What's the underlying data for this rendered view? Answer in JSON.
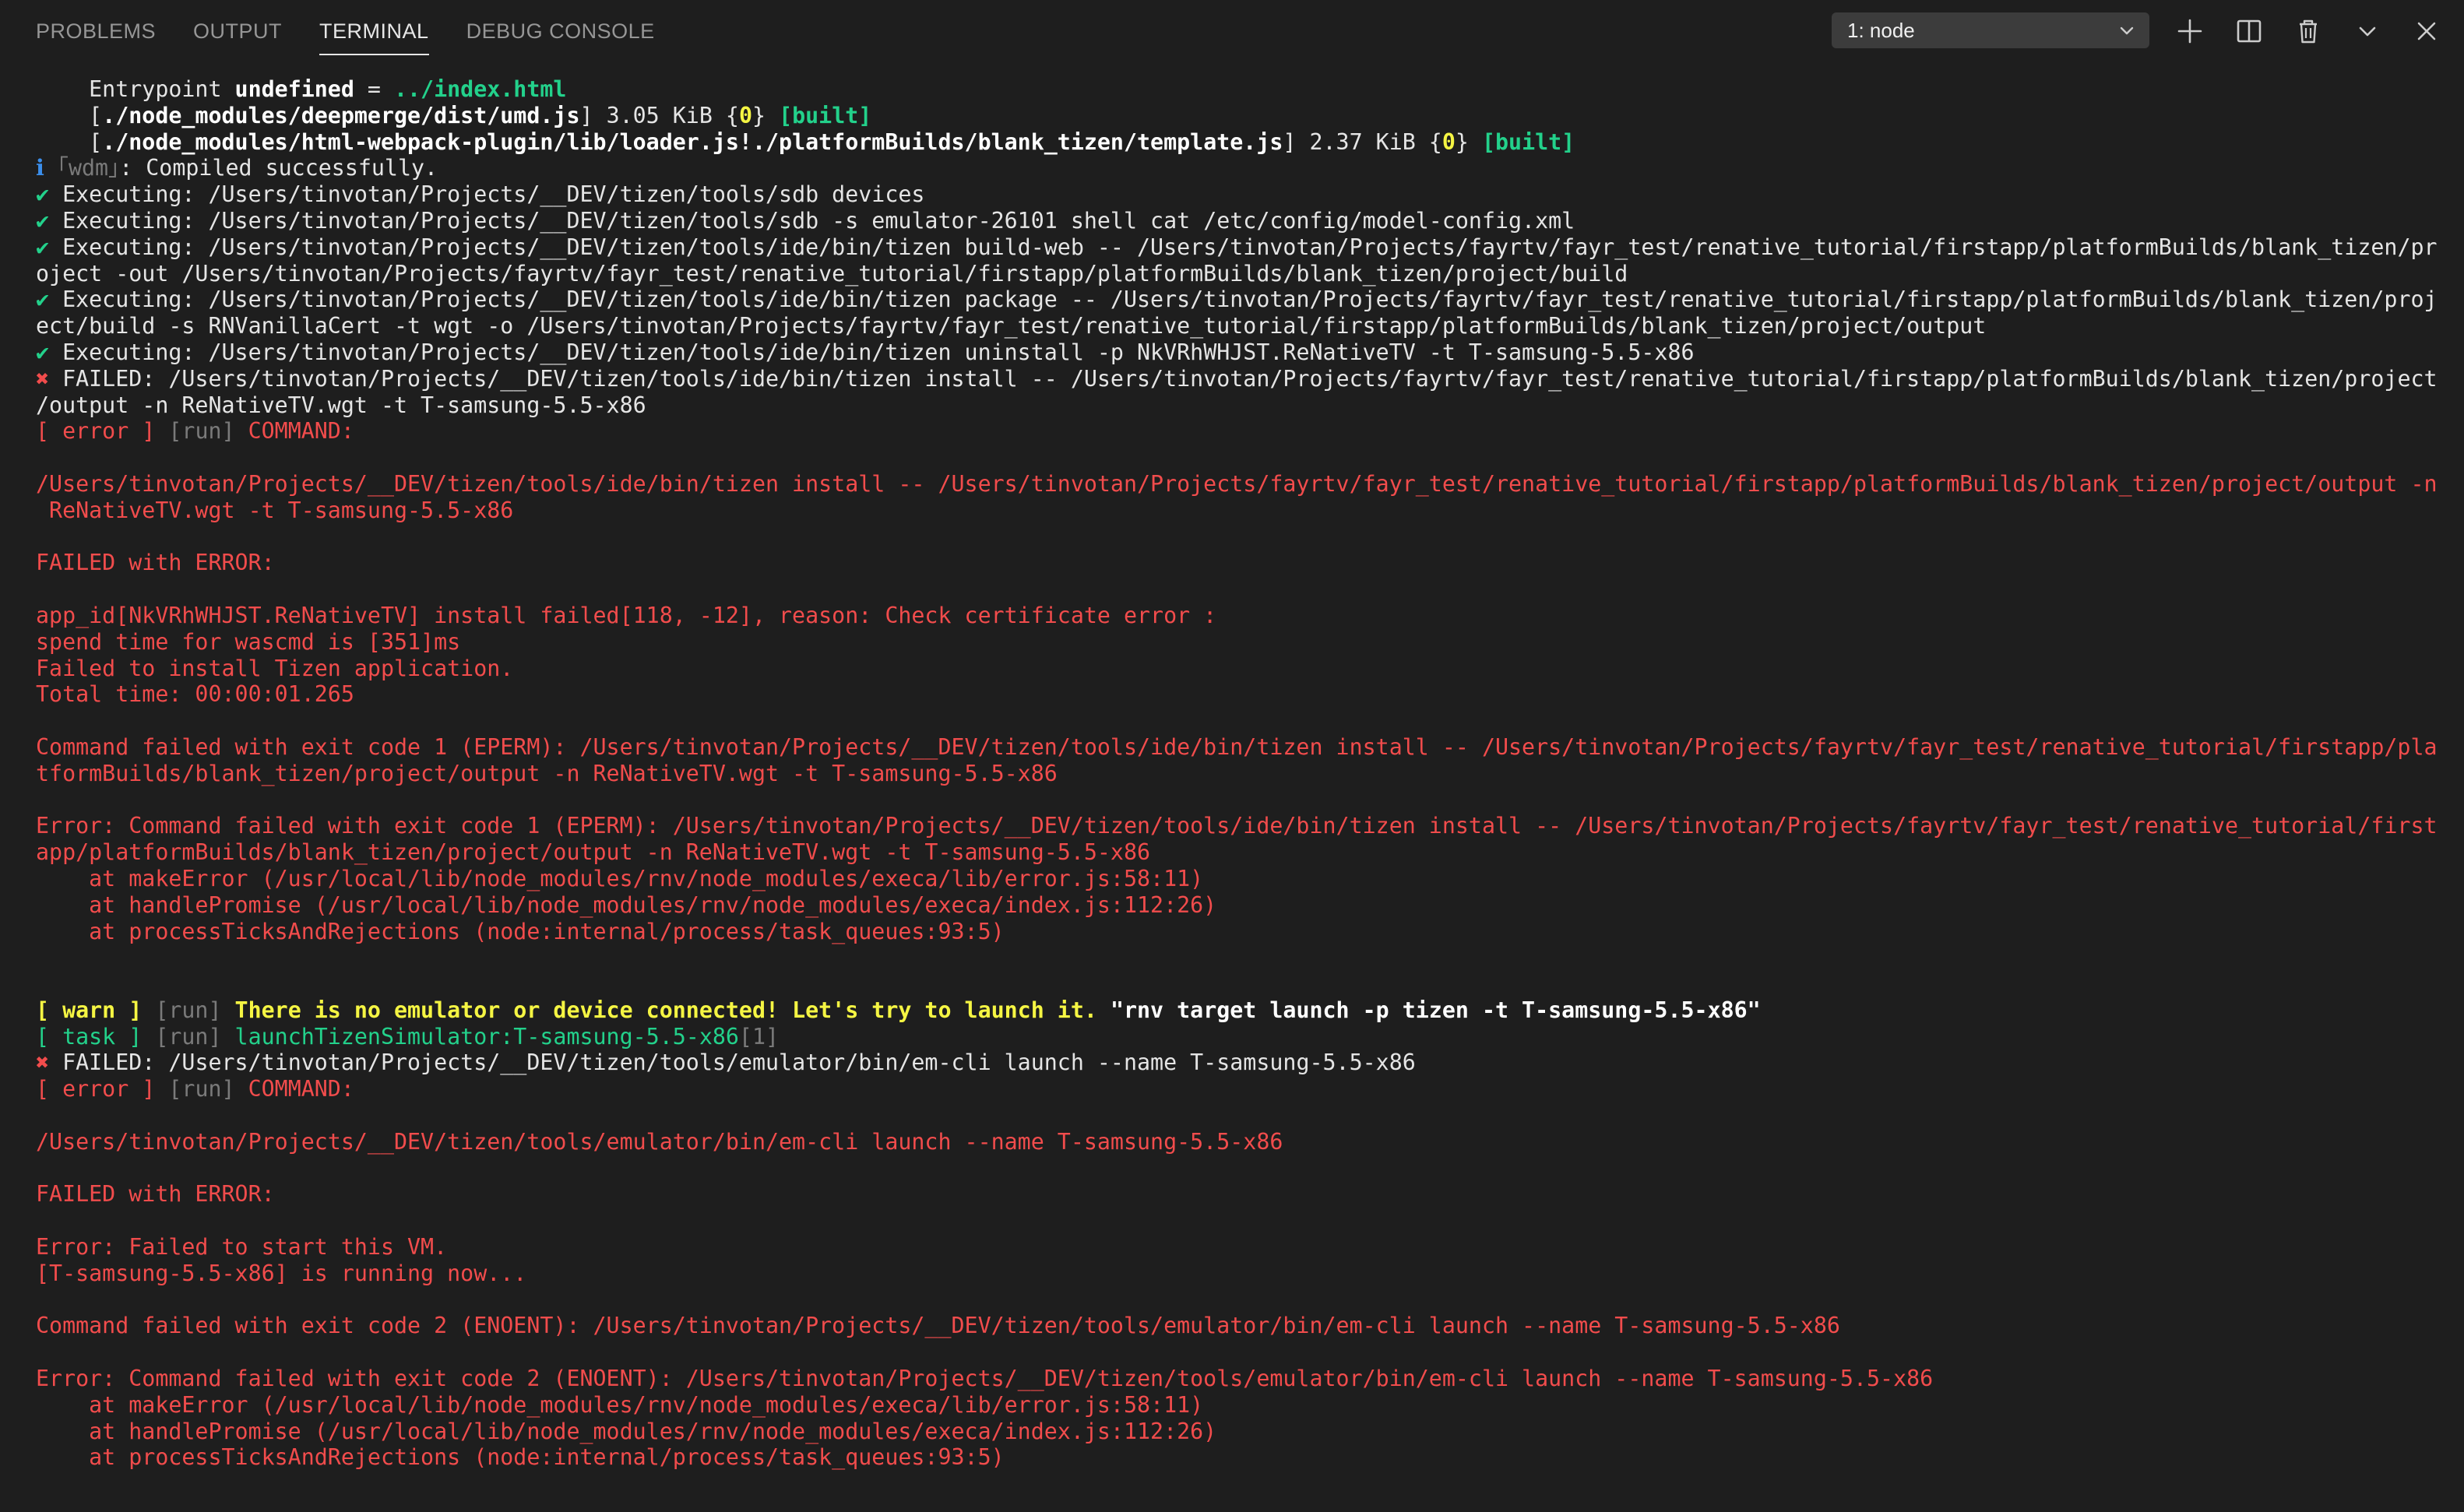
{
  "panel": {
    "tabs": [
      {
        "label": "PROBLEMS"
      },
      {
        "label": "OUTPUT"
      },
      {
        "label": "TERMINAL"
      },
      {
        "label": "DEBUG CONSOLE"
      }
    ],
    "active_tab": "TERMINAL",
    "terminal_select": {
      "value": "1: node"
    },
    "icons": [
      "plus-icon",
      "split-icon",
      "trash-icon",
      "chevron-down-icon",
      "close-icon"
    ]
  },
  "colors": {
    "background": "#1e1e1e",
    "error": "#f14c4c",
    "success": "#23d18b",
    "warn": "#f5f543"
  },
  "terminal": {
    "lines": [
      [
        {
          "t": "    Entrypoint ",
          "c": "w"
        },
        {
          "t": "undefined",
          "c": "b"
        },
        {
          "t": " = ",
          "c": "w"
        },
        {
          "t": "../index.html",
          "c": "gb"
        }
      ],
      [
        {
          "t": "    [",
          "c": "w"
        },
        {
          "t": "./node_modules/deepmerge/dist/umd.js",
          "c": "b"
        },
        {
          "t": "] 3.05 KiB {",
          "c": "w"
        },
        {
          "t": "0",
          "c": "yb"
        },
        {
          "t": "} ",
          "c": "w"
        },
        {
          "t": "[built]",
          "c": "gb"
        }
      ],
      [
        {
          "t": "    [",
          "c": "w"
        },
        {
          "t": "./node_modules/html-webpack-plugin/lib/loader.js!./platformBuilds/blank_tizen/template.js",
          "c": "b"
        },
        {
          "t": "] 2.37 KiB {",
          "c": "w"
        },
        {
          "t": "0",
          "c": "yb"
        },
        {
          "t": "} ",
          "c": "w"
        },
        {
          "t": "[built]",
          "c": "gb"
        }
      ],
      [
        {
          "t": "ℹ ",
          "c": "bl"
        },
        {
          "t": "｢wdm｣",
          "c": "gr"
        },
        {
          "t": ": Compiled successfully.",
          "c": "w"
        }
      ],
      [
        {
          "t": "✔ ",
          "c": "ck"
        },
        {
          "t": "Executing: /Users/tinvotan/Projects/__DEV/tizen/tools/sdb devices",
          "c": "w"
        }
      ],
      [
        {
          "t": "✔ ",
          "c": "ck"
        },
        {
          "t": "Executing: /Users/tinvotan/Projects/__DEV/tizen/tools/sdb -s emulator-26101 shell cat /etc/config/model-config.xml",
          "c": "w"
        }
      ],
      [
        {
          "t": "✔ ",
          "c": "ck"
        },
        {
          "t": "Executing: /Users/tinvotan/Projects/__DEV/tizen/tools/ide/bin/tizen build-web -- /Users/tinvotan/Projects/fayrtv/fayr_test/renative_tutorial/firstapp/platformBuilds/blank_tizen/pr",
          "c": "w"
        }
      ],
      [
        {
          "t": "oject -out /Users/tinvotan/Projects/fayrtv/fayr_test/renative_tutorial/firstapp/platformBuilds/blank_tizen/project/build",
          "c": "w"
        }
      ],
      [
        {
          "t": "✔ ",
          "c": "ck"
        },
        {
          "t": "Executing: /Users/tinvotan/Projects/__DEV/tizen/tools/ide/bin/tizen package -- /Users/tinvotan/Projects/fayrtv/fayr_test/renative_tutorial/firstapp/platformBuilds/blank_tizen/proj",
          "c": "w"
        }
      ],
      [
        {
          "t": "ect/build -s RNVanillaCert -t wgt -o /Users/tinvotan/Projects/fayrtv/fayr_test/renative_tutorial/firstapp/platformBuilds/blank_tizen/project/output",
          "c": "w"
        }
      ],
      [
        {
          "t": "✔ ",
          "c": "ck"
        },
        {
          "t": "Executing: /Users/tinvotan/Projects/__DEV/tizen/tools/ide/bin/tizen uninstall -p NkVRhWHJST.ReNativeTV -t T-samsung-5.5-x86",
          "c": "w"
        }
      ],
      [
        {
          "t": "✖ ",
          "c": "r"
        },
        {
          "t": "FAILED: /Users/tinvotan/Projects/__DEV/tizen/tools/ide/bin/tizen install -- /Users/tinvotan/Projects/fayrtv/fayr_test/renative_tutorial/firstapp/platformBuilds/blank_tizen/project",
          "c": "w"
        }
      ],
      [
        {
          "t": "/output -n ReNativeTV.wgt -t T-samsung-5.5-x86",
          "c": "w"
        }
      ],
      [
        {
          "t": "[ error ] ",
          "c": "r"
        },
        {
          "t": "[run] ",
          "c": "gr"
        },
        {
          "t": "COMMAND:",
          "c": "r"
        }
      ],
      [],
      [
        {
          "t": "/Users/tinvotan/Projects/__DEV/tizen/tools/ide/bin/tizen install -- /Users/tinvotan/Projects/fayrtv/fayr_test/renative_tutorial/firstapp/platformBuilds/blank_tizen/project/output -n",
          "c": "r"
        }
      ],
      [
        {
          "t": " ReNativeTV.wgt -t T-samsung-5.5-x86",
          "c": "r"
        }
      ],
      [],
      [
        {
          "t": "FAILED with ERROR:",
          "c": "r"
        }
      ],
      [],
      [
        {
          "t": "app_id[NkVRhWHJST.ReNativeTV] install failed[118, -12], reason: Check certificate error :",
          "c": "r"
        }
      ],
      [
        {
          "t": "spend time for wascmd is [351]ms",
          "c": "r"
        }
      ],
      [
        {
          "t": "Failed to install Tizen application.",
          "c": "r"
        }
      ],
      [
        {
          "t": "Total time: 00:00:01.265",
          "c": "r"
        }
      ],
      [],
      [
        {
          "t": "Command failed with exit code 1 (EPERM): /Users/tinvotan/Projects/__DEV/tizen/tools/ide/bin/tizen install -- /Users/tinvotan/Projects/fayrtv/fayr_test/renative_tutorial/firstapp/pla",
          "c": "r"
        }
      ],
      [
        {
          "t": "tformBuilds/blank_tizen/project/output -n ReNativeTV.wgt -t T-samsung-5.5-x86",
          "c": "r"
        }
      ],
      [],
      [
        {
          "t": "Error: Command failed with exit code 1 (EPERM): /Users/tinvotan/Projects/__DEV/tizen/tools/ide/bin/tizen install -- /Users/tinvotan/Projects/fayrtv/fayr_test/renative_tutorial/first",
          "c": "r"
        }
      ],
      [
        {
          "t": "app/platformBuilds/blank_tizen/project/output -n ReNativeTV.wgt -t T-samsung-5.5-x86",
          "c": "r"
        }
      ],
      [
        {
          "t": "    at makeError (/usr/local/lib/node_modules/rnv/node_modules/execa/lib/error.js:58:11)",
          "c": "r"
        }
      ],
      [
        {
          "t": "    at handlePromise (/usr/local/lib/node_modules/rnv/node_modules/execa/index.js:112:26)",
          "c": "r"
        }
      ],
      [
        {
          "t": "    at processTicksAndRejections (node:internal/process/task_queues:93:5)",
          "c": "r"
        }
      ],
      [],
      [],
      [
        {
          "t": "[ warn ] ",
          "c": "yb"
        },
        {
          "t": "[run] ",
          "c": "gr"
        },
        {
          "t": "There is no emulator or device connected! Let's try to launch it. ",
          "c": "yb"
        },
        {
          "t": "\"rnv target launch -p tizen -t T-samsung-5.5-x86\"",
          "c": "b"
        }
      ],
      [
        {
          "t": "[ task ] ",
          "c": "g"
        },
        {
          "t": "[run] ",
          "c": "gr"
        },
        {
          "t": "launchTizenSimulator:T-samsung-5.5-x86",
          "c": "g"
        },
        {
          "t": "[1]",
          "c": "gr"
        }
      ],
      [
        {
          "t": "✖ ",
          "c": "r"
        },
        {
          "t": "FAILED: /Users/tinvotan/Projects/__DEV/tizen/tools/emulator/bin/em-cli launch --name T-samsung-5.5-x86",
          "c": "w"
        }
      ],
      [
        {
          "t": "[ error ] ",
          "c": "r"
        },
        {
          "t": "[run] ",
          "c": "gr"
        },
        {
          "t": "COMMAND:",
          "c": "r"
        }
      ],
      [],
      [
        {
          "t": "/Users/tinvotan/Projects/__DEV/tizen/tools/emulator/bin/em-cli launch --name T-samsung-5.5-x86",
          "c": "r"
        }
      ],
      [],
      [
        {
          "t": "FAILED with ERROR:",
          "c": "r"
        }
      ],
      [],
      [
        {
          "t": "Error: Failed to start this VM.",
          "c": "r"
        }
      ],
      [
        {
          "t": "[T-samsung-5.5-x86] is running now...",
          "c": "r"
        }
      ],
      [],
      [
        {
          "t": "Command failed with exit code 2 (ENOENT): /Users/tinvotan/Projects/__DEV/tizen/tools/emulator/bin/em-cli launch --name T-samsung-5.5-x86",
          "c": "r"
        }
      ],
      [],
      [
        {
          "t": "Error: Command failed with exit code 2 (ENOENT): /Users/tinvotan/Projects/__DEV/tizen/tools/emulator/bin/em-cli launch --name T-samsung-5.5-x86",
          "c": "r"
        }
      ],
      [
        {
          "t": "    at makeError (/usr/local/lib/node_modules/rnv/node_modules/execa/lib/error.js:58:11)",
          "c": "r"
        }
      ],
      [
        {
          "t": "    at handlePromise (/usr/local/lib/node_modules/rnv/node_modules/execa/index.js:112:26)",
          "c": "r"
        }
      ],
      [
        {
          "t": "    at processTicksAndRejections (node:internal/process/task_queues:93:5)",
          "c": "r"
        }
      ]
    ]
  }
}
